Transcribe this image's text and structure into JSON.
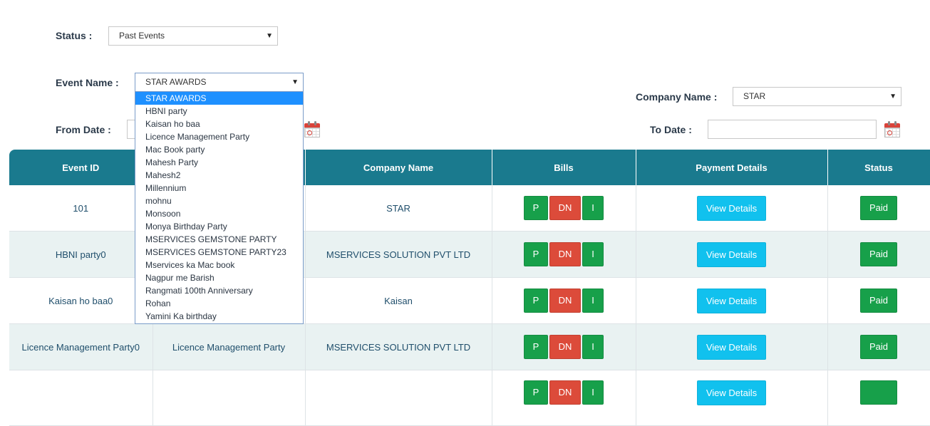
{
  "filters": {
    "status_label": "Status :",
    "status_value": "Past Events",
    "event_label": "Event Name :",
    "event_value": "STAR AWARDS",
    "company_label": "Company Name :",
    "company_value": "STAR",
    "from_label": "From Date :",
    "to_label": "To Date :",
    "calendar_icon": "calendar-icon"
  },
  "event_options": [
    "STAR AWARDS",
    "HBNI party",
    "Kaisan ho baa",
    "Licence Management Party",
    "Mac Book party",
    "Mahesh Party",
    "Mahesh2",
    "Millennium",
    "mohnu",
    "Monsoon",
    "Monya Birthday Party",
    "MSERVICES GEMSTONE PARTY",
    "MSERVICES GEMSTONE PARTY23",
    "Mservices ka Mac book",
    "Nagpur me Barish",
    "Rangmati 100th Anniversary",
    "Rohan",
    "Yamini Ka birthday"
  ],
  "table": {
    "headers": [
      "Event ID",
      "",
      "Company Name",
      "Bills",
      "Payment Details",
      "Status"
    ],
    "rows": [
      {
        "event_id": "101",
        "event_name": "",
        "company": "STAR",
        "status": "Paid"
      },
      {
        "event_id": "HBNI party0",
        "event_name": "",
        "company": "MSERVICES SOLUTION PVT LTD",
        "status": "Paid"
      },
      {
        "event_id": "Kaisan ho baa0",
        "event_name": "",
        "company": "Kaisan",
        "status": "Paid"
      },
      {
        "event_id": "Licence Management Party0",
        "event_name": "Licence Management Party",
        "company": "MSERVICES SOLUTION PVT LTD",
        "status": "Paid"
      }
    ],
    "bill_buttons": {
      "p": "P",
      "dn": "DN",
      "i": "I"
    },
    "view_label": "View Details"
  },
  "colors": {
    "header": "#1a7a8e",
    "green": "#17a04a",
    "red": "#dc4b3a",
    "cyan": "#11c1ee",
    "highlight": "#1e90ff"
  }
}
